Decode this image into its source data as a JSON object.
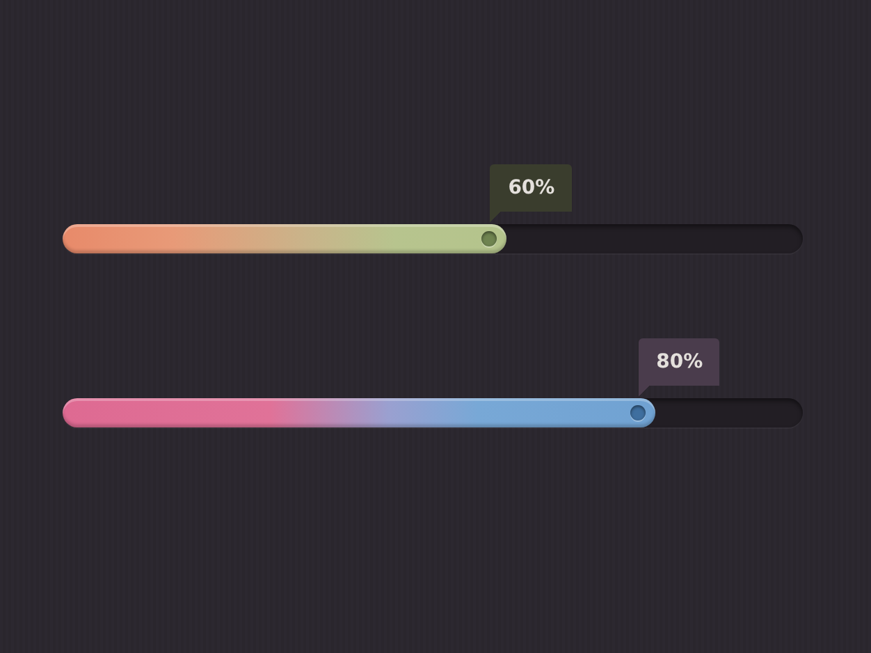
{
  "sliders": [
    {
      "kind": "warm",
      "level": 0.6,
      "reading": "60%"
    },
    {
      "kind": "cool",
      "level": 0.8,
      "reading": "80%"
    }
  ]
}
